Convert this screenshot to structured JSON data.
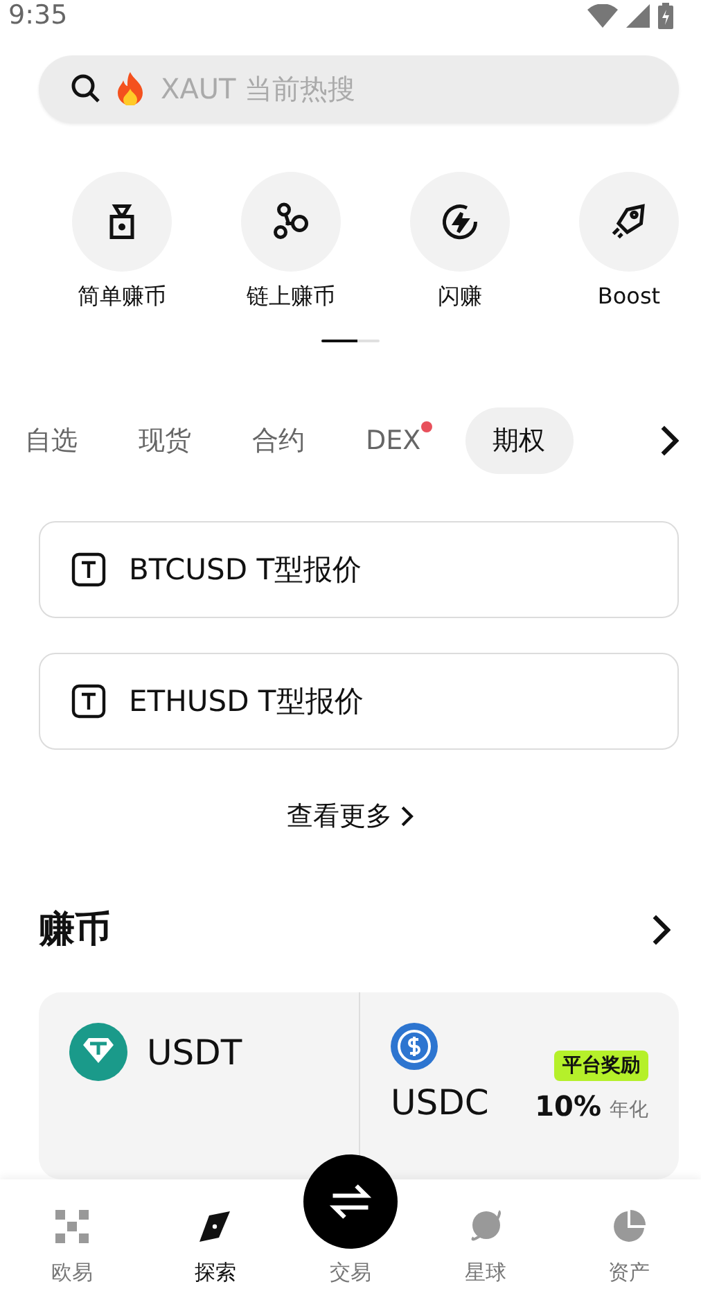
{
  "status_bar": {
    "time": "9:35"
  },
  "search": {
    "placeholder": "XAUT 当前热搜"
  },
  "shortcuts": [
    {
      "label": "简单赚币",
      "kind": "weight"
    },
    {
      "label": "链上赚币",
      "kind": "nodes"
    },
    {
      "label": "闪赚",
      "kind": "flash"
    },
    {
      "label": "Boost",
      "kind": "rocket"
    }
  ],
  "market_tabs": [
    {
      "label": "自选",
      "selected": false,
      "dot": false
    },
    {
      "label": "现货",
      "selected": false,
      "dot": false
    },
    {
      "label": "合约",
      "selected": false,
      "dot": false
    },
    {
      "label": "DEX",
      "selected": false,
      "dot": true
    },
    {
      "label": "期权",
      "selected": true,
      "dot": false
    }
  ],
  "quote_cards": [
    {
      "label": "BTCUSD T型报价"
    },
    {
      "label": "ETHUSD T型报价"
    }
  ],
  "more_link": "查看更多",
  "earn": {
    "title": "赚币",
    "coins": [
      {
        "symbol": "USDT",
        "kind": "tether"
      },
      {
        "symbol": "USDC",
        "kind": "usdc",
        "badge": "平台奖励",
        "rate": "10%",
        "rate_unit": "年化"
      }
    ]
  },
  "bottom_nav": [
    {
      "label": "欧易",
      "kind": "grid",
      "selected": false
    },
    {
      "label": "探索",
      "kind": "compass",
      "selected": true
    },
    {
      "label": "交易",
      "kind": "swap",
      "selected": false
    },
    {
      "label": "星球",
      "kind": "planet",
      "selected": false
    },
    {
      "label": "资产",
      "kind": "pie",
      "selected": false
    }
  ]
}
